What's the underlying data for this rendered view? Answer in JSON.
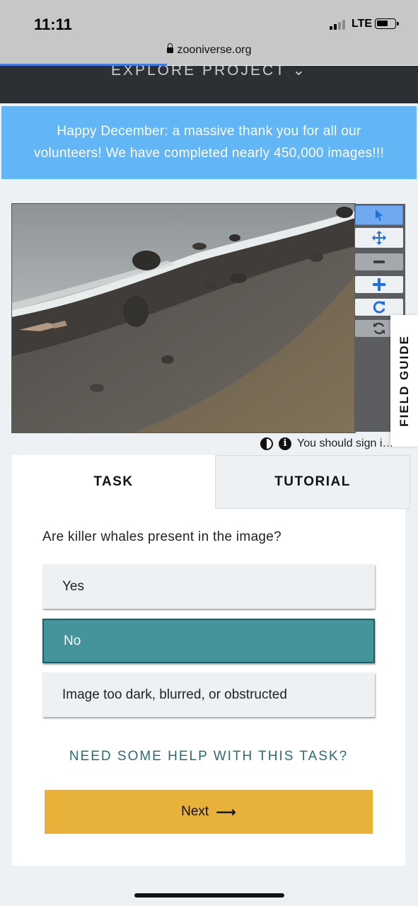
{
  "status": {
    "time": "11:11",
    "network": "LTE"
  },
  "browser": {
    "url": "zooniverse.org",
    "lock_icon": "lock-icon"
  },
  "header": {
    "explore_label": "EXPLORE PROJECT ⌄"
  },
  "banner": {
    "line1": "Happy December: a massive thank you for all our",
    "line2": "volunteers! We have completed nearly 450,000 images!!!"
  },
  "toolbar": {
    "tools": [
      {
        "name": "pointer-icon",
        "glyph": "➤"
      },
      {
        "name": "move-icon",
        "glyph": "✥"
      },
      {
        "name": "zoom-out-icon",
        "glyph": "−"
      },
      {
        "name": "zoom-in-icon",
        "glyph": "+"
      },
      {
        "name": "rotate-icon",
        "glyph": "↻"
      },
      {
        "name": "reset-icon",
        "glyph": "⟳"
      }
    ]
  },
  "field_guide": {
    "label": "FIELD GUIDE"
  },
  "subject_meta": {
    "sign_in_text": "You should sign i…"
  },
  "tabs": {
    "task": "TASK",
    "tutorial": "TUTORIAL"
  },
  "task": {
    "question": "Are killer whales present in the image?",
    "answers": [
      {
        "label": "Yes",
        "selected": false
      },
      {
        "label": "No",
        "selected": true
      },
      {
        "label": "Image too dark, blurred, or obstructed",
        "selected": false
      }
    ],
    "help_link": "NEED SOME HELP WITH THIS TASK?",
    "next_label": "Next",
    "next_arrow": "⟶"
  },
  "colors": {
    "banner": "#63b6f5",
    "selected_answer": "#43959b",
    "next_button": "#e8b23a",
    "help_link": "#2c6c74",
    "active_tool": "#70a9f0"
  }
}
